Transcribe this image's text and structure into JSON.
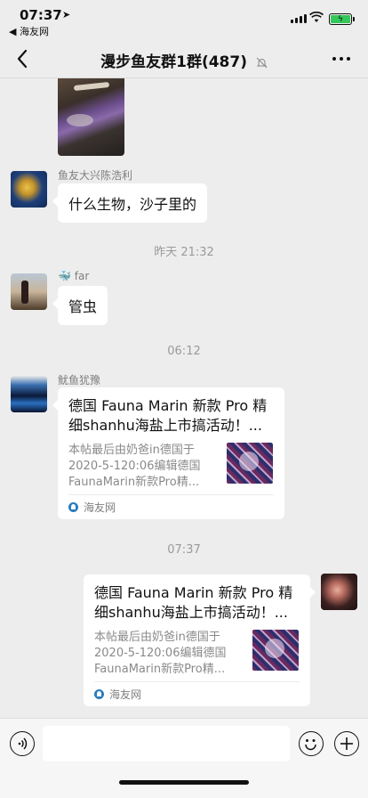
{
  "status_bar": {
    "time": "07:37",
    "back_app": "◀ 海友网",
    "battery_color": "#34c759"
  },
  "nav": {
    "title": "漫步鱼友群1群(487)"
  },
  "messages": [
    {
      "type": "image",
      "sender": ""
    },
    {
      "type": "text",
      "sender": "鱼友大兴陈浩利",
      "text": "什么生物，沙子里的"
    },
    {
      "type": "time",
      "text": "昨天 21:32"
    },
    {
      "type": "text",
      "sender": "far",
      "text": "管虫"
    },
    {
      "type": "time",
      "text": "06:12"
    },
    {
      "type": "link",
      "sender": "鱿鱼犹豫",
      "title": "德国 Fauna Marin 新款 Pro 精细shanhu海盐上市搞活动！...",
      "desc": "本帖最后由奶爸in德国于2020-5-120:06编辑德国FaunaMarin新款Pro精...",
      "source": "海友网"
    },
    {
      "type": "time",
      "text": "07:37"
    },
    {
      "type": "link",
      "sender": "self",
      "title": "德国 Fauna Marin 新款 Pro 精细shanhu海盐上市搞活动！...",
      "desc": "本帖最后由奶爸in德国于2020-5-120:06编辑德国FaunaMarin新款Pro精...",
      "source": "海友网"
    }
  ],
  "input": {
    "value": "",
    "placeholder": ""
  }
}
